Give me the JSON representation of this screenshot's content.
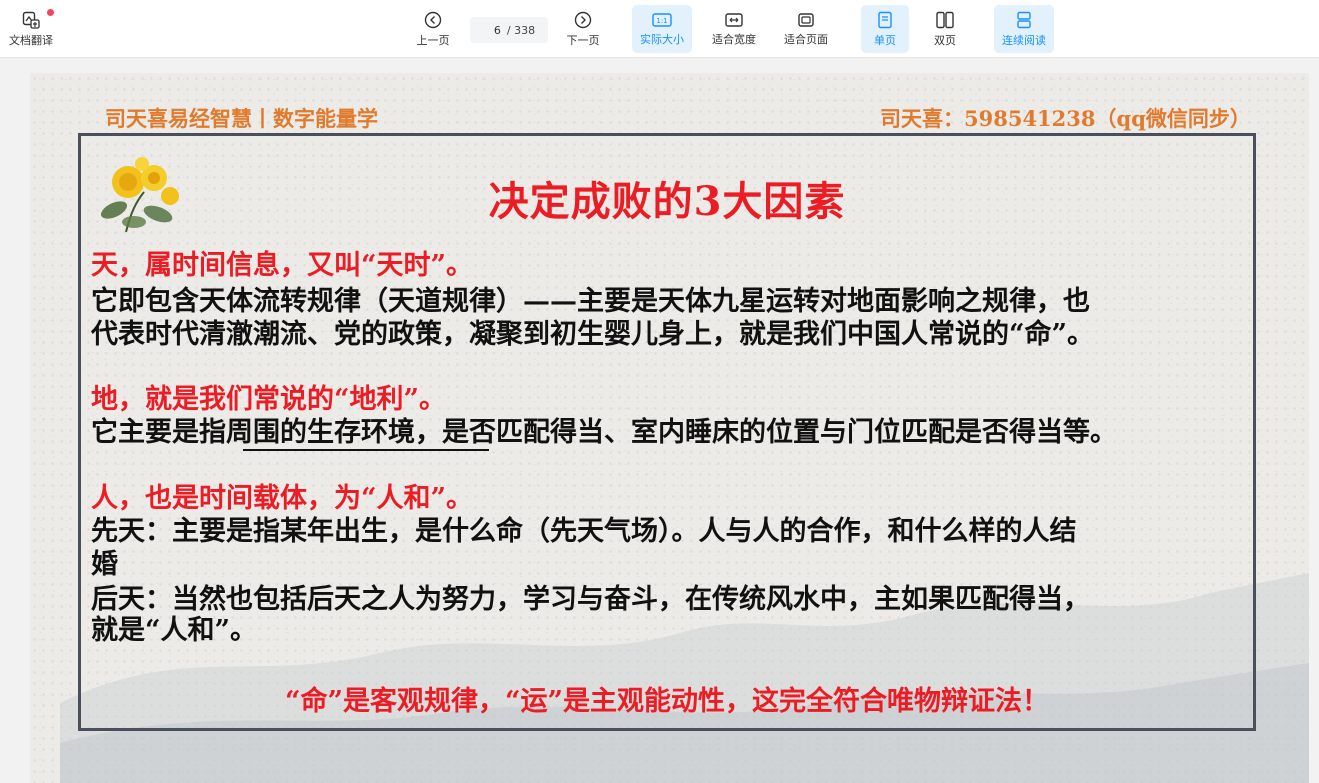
{
  "toolbar": {
    "translate_label": "文档翻译",
    "prev_label": "上一页",
    "next_label": "下一页",
    "current_page": "6",
    "total_pages": "/ 338",
    "actual_size_label": "实际大小",
    "fit_width_label": "适合宽度",
    "fit_page_label": "适合页面",
    "single_page_label": "单页",
    "double_page_label": "双页",
    "continuous_label": "连续阅读",
    "accent_color": "#1890ff",
    "active_bg": "#e3f1fd"
  },
  "slide": {
    "header_left": "司天喜易经智慧丨数字能量学",
    "header_right": "司天喜：598541238（qq微信同步）",
    "title": "决定成败的3大因素",
    "section_tian_heading": "天，属时间信息，又叫“天时”。",
    "section_tian_line1": "它即包含天体流转规律（天道规律）——主要是天体九星运转对地面影响之规律，也",
    "section_tian_line2": "代表时代清澈潮流、党的政策，凝聚到初生婴儿身上，就是我们中国人常说的“命”。",
    "section_di_heading": "地，就是我们常说的“地利”。",
    "section_di_line1": "它主要是指周围的生存环境，是否匹配得当、室内睡床的位置与门位匹配是否得当等。",
    "section_ren_heading": "人，也是时间载体，为“人和”。",
    "section_ren_line1": "先天：主要是指某年出生，是什么命（先天气场）。人与人的合作，和什么样的人结",
    "section_ren_line2": "婚",
    "section_ren_line3": "后天：当然也包括后天之人为努力，学习与奋斗，在传统风水中，主如果匹配得当，",
    "section_ren_line4": "就是“人和”。",
    "conclusion": "“命”是客观规律，“运”是主观能动性，这完全符合唯物辩证法！",
    "header_color": "#e07b2e",
    "accent_red": "#ec1c24",
    "frame_color": "#4a4f5c"
  },
  "icons": [
    "translate-icon",
    "prev-page-icon",
    "next-page-icon",
    "actual-size-icon",
    "fit-width-icon",
    "fit-page-icon",
    "single-page-icon",
    "double-page-icon",
    "continuous-read-icon",
    "chrysanthemum-icon"
  ]
}
